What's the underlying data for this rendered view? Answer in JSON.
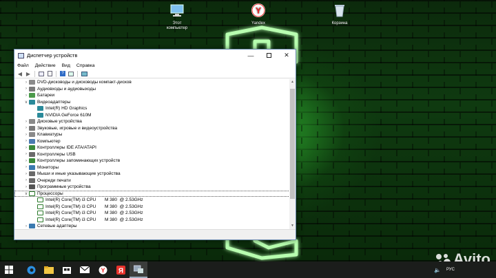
{
  "desktop": {
    "icons": [
      {
        "label_line1": "Этот",
        "label_line2": "компьютер",
        "icon": "computer-icon"
      },
      {
        "label_line1": "Yandex",
        "label_line2": "",
        "icon": "yandex-browser-icon"
      },
      {
        "label_line1": "Корзина",
        "label_line2": "",
        "icon": "recycle-bin-icon"
      }
    ]
  },
  "window": {
    "title": "Диспетчер устройств",
    "menu": [
      "Файл",
      "Действие",
      "Вид",
      "Справка"
    ],
    "tree": [
      {
        "label": "DVD-дисководы и дисководы компакт-дисков",
        "level": 0,
        "expanded": false,
        "icon": "dvd-drive-icon",
        "color": "#8a8a8a"
      },
      {
        "label": "Аудиовходы и аудиовыходы",
        "level": 0,
        "expanded": false,
        "icon": "audio-icon",
        "color": "#7a7a7a"
      },
      {
        "label": "Батареи",
        "level": 0,
        "expanded": false,
        "icon": "battery-icon",
        "color": "#4a9a4a"
      },
      {
        "label": "Видеоадаптеры",
        "level": 0,
        "expanded": true,
        "icon": "display-adapter-icon",
        "color": "#2a8a9a"
      },
      {
        "label": "Intel(R) HD Graphics",
        "level": 1,
        "icon": "display-adapter-icon",
        "color": "#2a8a9a"
      },
      {
        "label": "NVIDIA GeForce 610M",
        "level": 1,
        "icon": "display-adapter-icon",
        "color": "#2a8a9a"
      },
      {
        "label": "Дисковые устройства",
        "level": 0,
        "expanded": false,
        "icon": "disk-drive-icon",
        "color": "#8a8a8a"
      },
      {
        "label": "Звуковые, игровые и видеоустройства",
        "level": 0,
        "expanded": false,
        "icon": "sound-icon",
        "color": "#7a7a7a"
      },
      {
        "label": "Клавиатуры",
        "level": 0,
        "expanded": false,
        "icon": "keyboard-icon",
        "color": "#8a8a8a"
      },
      {
        "label": "Компьютер",
        "level": 0,
        "expanded": false,
        "icon": "computer-icon",
        "color": "#4a7ab0"
      },
      {
        "label": "Контроллеры IDE ATA/ATAPI",
        "level": 0,
        "expanded": false,
        "icon": "ide-controller-icon",
        "color": "#3a8a3a"
      },
      {
        "label": "Контроллеры USB",
        "level": 0,
        "expanded": false,
        "icon": "usb-icon",
        "color": "#6a6a6a"
      },
      {
        "label": "Контроллеры запоминающих устройств",
        "level": 0,
        "expanded": false,
        "icon": "storage-controller-icon",
        "color": "#3a8a3a"
      },
      {
        "label": "Мониторы",
        "level": 0,
        "expanded": false,
        "icon": "monitor-icon",
        "color": "#3a7ab0"
      },
      {
        "label": "Мыши и иные указывающие устройства",
        "level": 0,
        "expanded": false,
        "icon": "mouse-icon",
        "color": "#6a6a6a"
      },
      {
        "label": "Очереди печати",
        "level": 0,
        "expanded": false,
        "icon": "printer-icon",
        "color": "#6a6a6a"
      },
      {
        "label": "Программные устройства",
        "level": 0,
        "expanded": false,
        "icon": "software-device-icon",
        "color": "#555555"
      },
      {
        "label": "Процессоры",
        "level": 0,
        "expanded": true,
        "selected": true,
        "icon": "processor-icon",
        "color": "#2a7a2a"
      },
      {
        "label": "Intel(R) Core(TM) i3 CPU       M 380  @ 2.53GHz",
        "level": 1,
        "icon": "processor-icon",
        "color": "#2a7a2a"
      },
      {
        "label": "Intel(R) Core(TM) i3 CPU       M 380  @ 2.53GHz",
        "level": 1,
        "icon": "processor-icon",
        "color": "#2a7a2a"
      },
      {
        "label": "Intel(R) Core(TM) i3 CPU       M 380  @ 2.53GHz",
        "level": 1,
        "icon": "processor-icon",
        "color": "#2a7a2a"
      },
      {
        "label": "Intel(R) Core(TM) i3 CPU       M 380  @ 2.53GHz",
        "level": 1,
        "icon": "processor-icon",
        "color": "#2a7a2a"
      },
      {
        "label": "Сетевые адаптеры",
        "level": 0,
        "expanded": false,
        "icon": "network-adapter-icon",
        "color": "#3a7ab0"
      }
    ]
  },
  "taskbar": {
    "items": [
      "start-icon",
      "edge-icon",
      "file-explorer-icon",
      "store-icon",
      "mail-icon",
      "yandex-browser-icon",
      "yandex-icon",
      "device-manager-icon"
    ],
    "tray_language": "РУС"
  },
  "watermark": "Avito",
  "colors": {
    "accent": "#0078d7",
    "neon": "#39ff39"
  }
}
